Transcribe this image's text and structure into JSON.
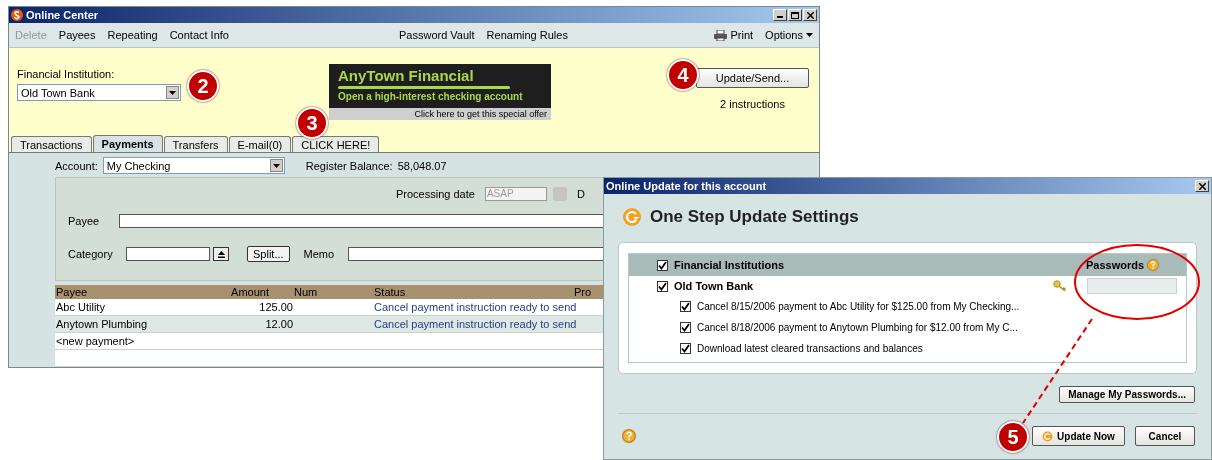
{
  "window": {
    "title": "Online Center"
  },
  "toolbar": {
    "left": [
      {
        "label": "Delete",
        "disabled": true
      },
      {
        "label": "Payees",
        "disabled": false
      },
      {
        "label": "Repeating",
        "disabled": false
      },
      {
        "label": "Contact Info",
        "disabled": false
      }
    ],
    "center": [
      "Password Vault",
      "Renaming Rules"
    ],
    "print": "Print",
    "options": "Options"
  },
  "institution": {
    "label": "Financial Institution:",
    "value": "Old Town Bank"
  },
  "ad": {
    "title": "AnyTown Financial",
    "subtitle": "Open a high-interest checking account",
    "link": "Click here to get this special offer"
  },
  "update": {
    "button": "Update/Send...",
    "note": "2 instructions"
  },
  "tabs": [
    {
      "label": "Transactions",
      "selected": false
    },
    {
      "label": "Payments",
      "selected": true
    },
    {
      "label": "Transfers",
      "selected": false
    },
    {
      "label": "E-mail(0)",
      "selected": false
    },
    {
      "label": "CLICK HERE!",
      "selected": false
    }
  ],
  "account": {
    "label": "Account:",
    "value": "My Checking",
    "balance_label": "Register Balance:",
    "balance": "58,048.07"
  },
  "form": {
    "processing_label": "Processing date",
    "processing_value": "ASAP",
    "column_label_cut": "D",
    "payee_label": "Payee",
    "category_label": "Category",
    "split_button": "Split...",
    "memo_label": "Memo"
  },
  "table": {
    "columns": [
      "Payee",
      "Amount",
      "Num",
      "Status",
      "Pro"
    ],
    "rows": [
      {
        "payee": "Abc Utility",
        "amount": "125.00",
        "status": "Cancel payment instruction ready to send"
      },
      {
        "payee": "Anytown Plumbing",
        "amount": "12.00",
        "status": "Cancel payment instruction ready to send"
      },
      {
        "payee": "<new payment>"
      }
    ]
  },
  "dialog": {
    "title": "Online Update for this account",
    "heading": "One Step Update Settings",
    "header": {
      "label": "Financial Institutions",
      "checked": true,
      "passwords": "Passwords"
    },
    "institution": {
      "label": "Old Town Bank",
      "checked": true
    },
    "items": [
      {
        "label": "Cancel 8/15/2006 payment to Abc Utility for $125.00 from My Checking...",
        "checked": true
      },
      {
        "label": "Cancel 8/18/2006 payment to Anytown Plumbing for $12.00 from My C...",
        "checked": true
      },
      {
        "label": "Download latest cleared transactions and balances",
        "checked": true
      }
    ],
    "manage_button": "Manage My Passwords...",
    "update_button": "Update Now",
    "cancel_button": "Cancel"
  },
  "callouts": [
    "2",
    "3",
    "4",
    "5"
  ]
}
